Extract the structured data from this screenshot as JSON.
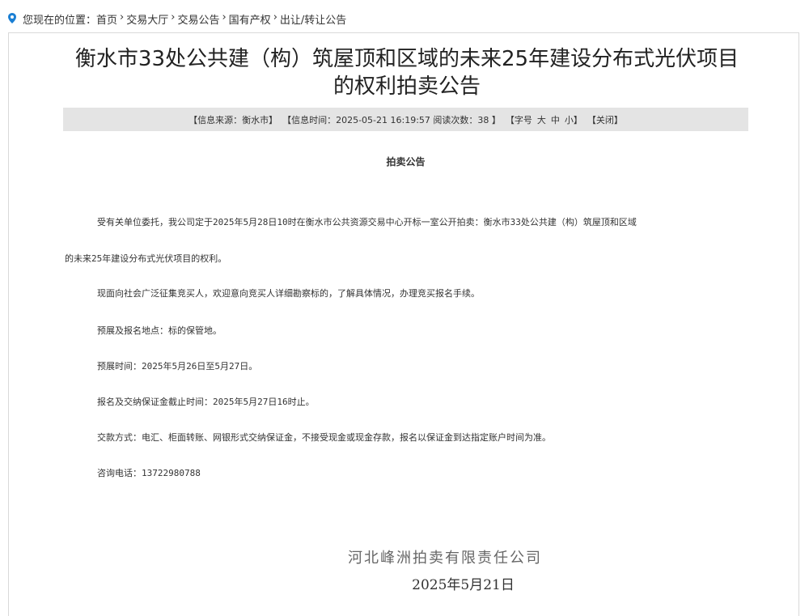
{
  "breadcrumb": {
    "prefix": "您现在的位置：",
    "items": [
      "首页",
      "交易大厅",
      "交易公告",
      "国有产权",
      "出让/转让公告"
    ],
    "separator": "›"
  },
  "article": {
    "title": "衡水市33处公共建（构）筑屋顶和区域的未来25年建设分布式光伏项目的权利拍卖公告",
    "info": {
      "source": "【信息来源：衡水市】",
      "time": "【信息时间：2025-05-21 16:19:57 阅读次数：38 】",
      "font_size_label": "【字号",
      "font_large": "大",
      "font_medium": "中",
      "font_small": "小",
      "font_size_close": "】",
      "close": "【关闭】"
    },
    "subtitle": "拍卖公告",
    "paragraphs": {
      "p1_line1": "受有关单位委托，我公司定于2025年5月28日10时在衡水市公共资源交易中心开标一室公开拍卖：衡水市33处公共建（构）筑屋顶和区域",
      "p1_line2": "的未来25年建设分布式光伏项目的权利。",
      "p2": "现面向社会广泛征集竞买人，欢迎意向竞买人详细勘察标的，了解具体情况，办理竞买报名手续。",
      "p3": "预展及报名地点：标的保管地。",
      "p4": "预展时间：2025年5月26日至5月27日。",
      "p5": "报名及交纳保证金截止时间：2025年5月27日16时止。",
      "p6": "交款方式：电汇、柜面转账、网银形式交纳保证金，不接受现金或现金存款，报名以保证金到达指定账户时间为准。",
      "p7": "咨询电话：13722980788"
    },
    "footer": {
      "company": "河北峰洲拍卖有限责任公司",
      "date": "2025年5月21日"
    }
  },
  "colors": {
    "location_icon": "#1a7fd4",
    "info_bar_bg": "#e4e4e4",
    "frame_border": "#d9d9d9"
  }
}
